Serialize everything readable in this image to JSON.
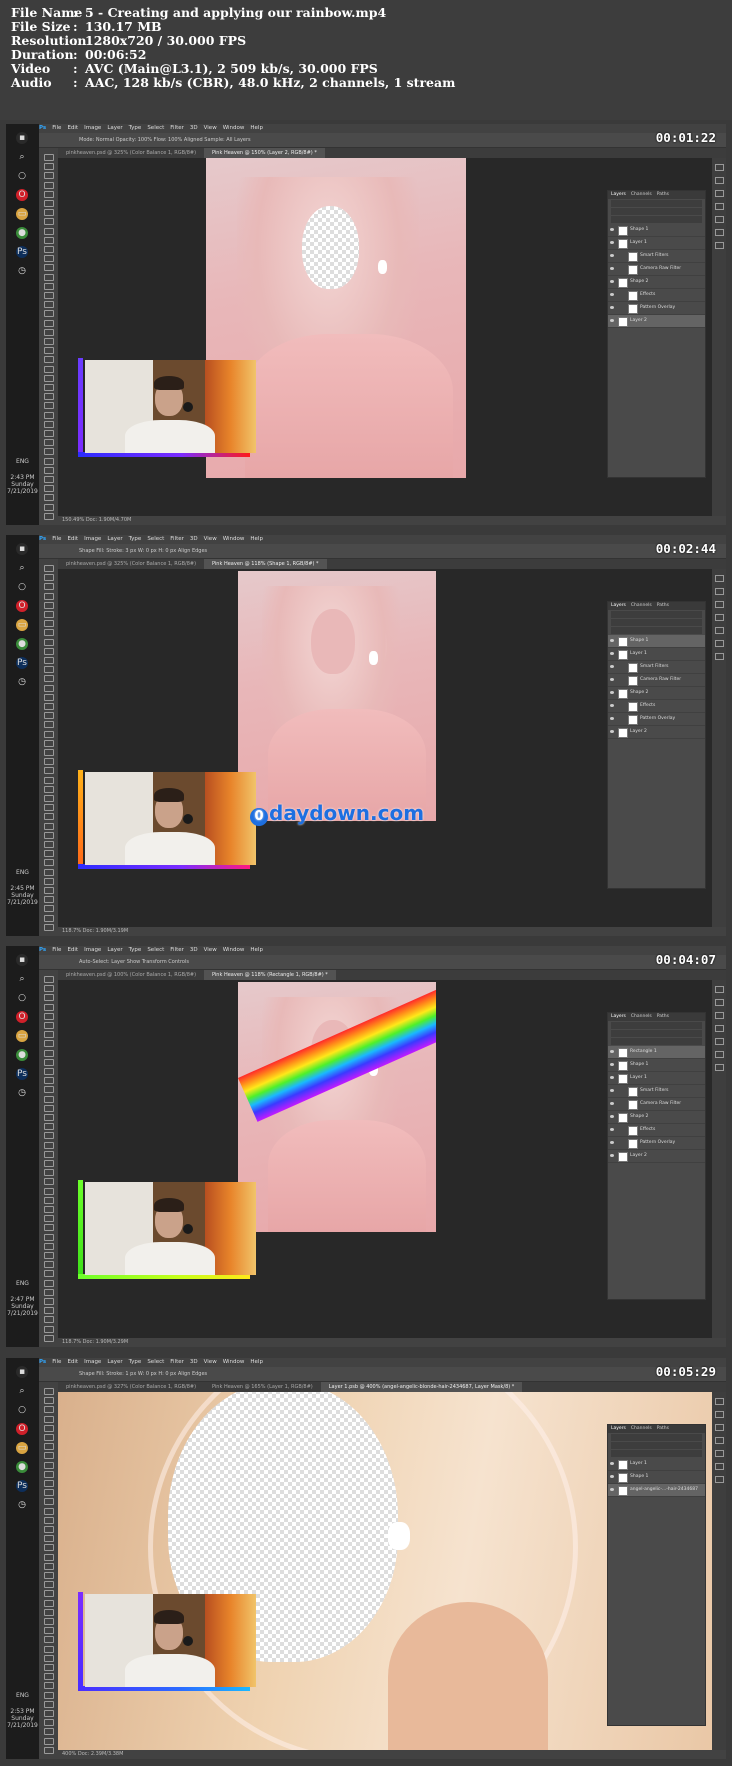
{
  "file_info": [
    {
      "key": "File Name",
      "value": "5 - Creating and applying our rainbow.mp4"
    },
    {
      "key": "File Size",
      "value": "130.17 MB"
    },
    {
      "key": "Resolution",
      "value": "1280x720 / 30.000 FPS"
    },
    {
      "key": "Duration",
      "value": "00:06:52"
    },
    {
      "key": "Video",
      "value": "AVC (Main@L3.1), 2 509 kb/s, 30.000 FPS"
    },
    {
      "key": "Audio",
      "value": "AAC, 128 kb/s (CBR), 48.0 kHz, 2 channels, 1 stream"
    }
  ],
  "menu": [
    "File",
    "Edit",
    "Image",
    "Layer",
    "Type",
    "Select",
    "Filter",
    "3D",
    "View",
    "Window",
    "Help"
  ],
  "panel_tabs": [
    "Layers",
    "Channels",
    "Paths"
  ],
  "taskbar": {
    "lang": "ENG"
  },
  "colors": {
    "accent": "#1e6fe0",
    "rainbow_purple": "#7b2cff",
    "rainbow_red": "#ff1a1a"
  },
  "frames": [
    {
      "timecode": "00:01:22",
      "options": "Mode: Normal   Opacity: 100%   Flow: 100%   Aligned   Sample: All Layers",
      "tabs": [
        "pinkheaven.psd @ 325% (Color Balance 1, RGB/8#)",
        "Pink Heaven @ 150% (Layer 2, RGB/8#) *"
      ],
      "status": "150.49%      Doc: 1.90M/4.70M",
      "clock": {
        "time": "2:43 PM",
        "day": "Sunday",
        "date": "7/21/2019"
      },
      "layers": [
        {
          "name": "Shape 1",
          "sub": false,
          "sel": false
        },
        {
          "name": "Layer 1",
          "sub": false,
          "sel": false
        },
        {
          "name": "Smart Filters",
          "sub": true,
          "sel": false
        },
        {
          "name": "Camera Raw Filter",
          "sub": true,
          "sel": false
        },
        {
          "name": "Shape 2",
          "sub": false,
          "sel": false
        },
        {
          "name": "Effects",
          "sub": true,
          "sel": false
        },
        {
          "name": "Pattern Overlay",
          "sub": true,
          "sel": false
        },
        {
          "name": "Layer 2",
          "sub": false,
          "sel": true
        }
      ]
    },
    {
      "timecode": "00:02:44",
      "options": "Shape   Fill:   Stroke:   3 px   W: 0 px   H: 0 px   Align Edges",
      "tabs": [
        "pinkheaven.psd @ 325% (Color Balance 1, RGB/8#)",
        "Pink Heaven @ 118% (Shape 1, RGB/8#) *"
      ],
      "status": "118.7%      Doc: 1.90M/3.19M",
      "clock": {
        "time": "2:45 PM",
        "day": "Sunday",
        "date": "7/21/2019"
      },
      "watermark": "daydown.com",
      "layers": [
        {
          "name": "Shape 1",
          "sub": false,
          "sel": true
        },
        {
          "name": "Layer 1",
          "sub": false,
          "sel": false
        },
        {
          "name": "Smart Filters",
          "sub": true,
          "sel": false
        },
        {
          "name": "Camera Raw Filter",
          "sub": true,
          "sel": false
        },
        {
          "name": "Shape 2",
          "sub": false,
          "sel": false
        },
        {
          "name": "Effects",
          "sub": true,
          "sel": false
        },
        {
          "name": "Pattern Overlay",
          "sub": true,
          "sel": false
        },
        {
          "name": "Layer 2",
          "sub": false,
          "sel": false
        }
      ]
    },
    {
      "timecode": "00:04:07",
      "options": "Auto-Select:   Layer   Show Transform Controls",
      "tabs": [
        "pinkheaven.psd @ 100% (Color Balance 1, RGB/8#)",
        "Pink Heaven @ 118% (Rectangle 1, RGB/8#) *"
      ],
      "status": "118.7%      Doc: 1.90M/3.29M",
      "clock": {
        "time": "2:47 PM",
        "day": "Sunday",
        "date": "7/21/2019"
      },
      "layers": [
        {
          "name": "Rectangle 1",
          "sub": false,
          "sel": true
        },
        {
          "name": "Shape 1",
          "sub": false,
          "sel": false
        },
        {
          "name": "Layer 1",
          "sub": false,
          "sel": false
        },
        {
          "name": "Smart Filters",
          "sub": true,
          "sel": false
        },
        {
          "name": "Camera Raw Filter",
          "sub": true,
          "sel": false
        },
        {
          "name": "Shape 2",
          "sub": false,
          "sel": false
        },
        {
          "name": "Effects",
          "sub": true,
          "sel": false
        },
        {
          "name": "Pattern Overlay",
          "sub": true,
          "sel": false
        },
        {
          "name": "Layer 2",
          "sub": false,
          "sel": false
        }
      ]
    },
    {
      "timecode": "00:05:29",
      "options": "Shape   Fill:   Stroke:   1 px   W: 0 px   H: 0 px   Align Edges",
      "tabs": [
        "pinkheaven.psd @ 327% (Color Balance 1, RGB/8#)",
        "Pink Heaven @ 165% (Layer 1, RGB/8#)",
        "Layer 1.psb @ 400% (angel-angelic-blonde-hair-2434687, Layer Mask/8) *"
      ],
      "status": "400%      Doc: 2.39M/3.38M",
      "clock": {
        "time": "2:53 PM",
        "day": "Sunday",
        "date": "7/21/2019"
      },
      "layers": [
        {
          "name": "Layer 1",
          "sub": false,
          "sel": false
        },
        {
          "name": "Shape 1",
          "sub": false,
          "sel": false
        },
        {
          "name": "angel-angelic-...-hair-2434687",
          "sub": false,
          "sel": true
        }
      ]
    }
  ]
}
